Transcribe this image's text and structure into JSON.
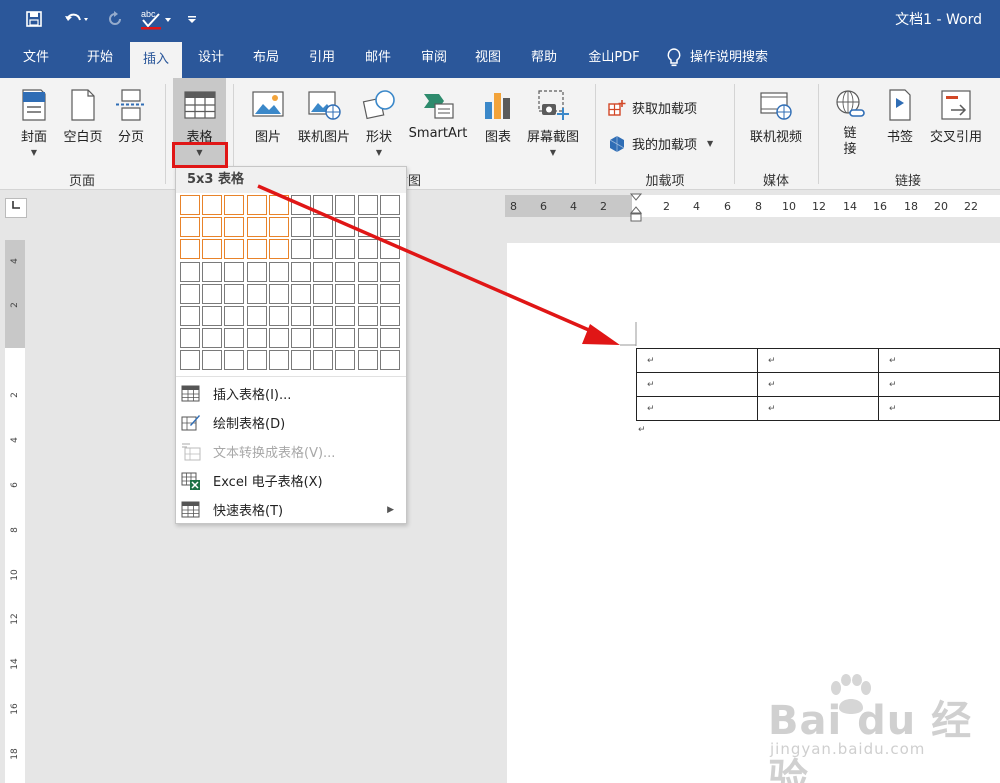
{
  "titlebar": {
    "doc_title": "文档1  -  Word",
    "qat": [
      {
        "name": "save-icon"
      },
      {
        "name": "undo-icon"
      },
      {
        "name": "redo-icon"
      },
      {
        "name": "spelling-icon",
        "text": "abc"
      },
      {
        "name": "customize-qat-icon"
      }
    ]
  },
  "tabs": [
    {
      "label": "文件",
      "active": false
    },
    {
      "label": "开始",
      "active": false
    },
    {
      "label": "插入",
      "active": true
    },
    {
      "label": "设计",
      "active": false
    },
    {
      "label": "布局",
      "active": false
    },
    {
      "label": "引用",
      "active": false
    },
    {
      "label": "邮件",
      "active": false
    },
    {
      "label": "审阅",
      "active": false
    },
    {
      "label": "视图",
      "active": false
    },
    {
      "label": "帮助",
      "active": false
    },
    {
      "label": "金山PDF",
      "active": false
    }
  ],
  "tell_me": "操作说明搜索",
  "ribbon": {
    "buttons": [
      {
        "label": "封面",
        "icon": "cover-page-icon"
      },
      {
        "label": "空白页",
        "icon": "blank-page-icon"
      },
      {
        "label": "分页",
        "icon": "page-break-icon"
      },
      {
        "label": "表格",
        "icon": "table-icon"
      },
      {
        "label": "图片",
        "icon": "picture-icon"
      },
      {
        "label": "联机图片",
        "icon": "online-picture-icon"
      },
      {
        "label": "形状",
        "icon": "shapes-icon"
      },
      {
        "label": "SmartArt",
        "icon": "smartart-icon"
      },
      {
        "label": "图表",
        "icon": "chart-icon"
      },
      {
        "label": "屏幕截图",
        "icon": "screenshot-icon"
      },
      {
        "label": "联机视频",
        "icon": "online-video-icon"
      },
      {
        "label": "链\n接",
        "icon": "link-icon"
      },
      {
        "label": "书签",
        "icon": "bookmark-icon"
      },
      {
        "label": "交叉引用",
        "icon": "cross-reference-icon"
      }
    ],
    "addins": {
      "get": "获取加载项",
      "mine": "我的加载项"
    },
    "groups": {
      "pages": "页面",
      "illustrations_tail": "插图",
      "addins": "加载项",
      "media": "媒体",
      "links": "链接"
    }
  },
  "dropdown": {
    "title": "5x3 表格",
    "grid": {
      "cols": 10,
      "rows": 8,
      "hi_cols": 5,
      "hi_rows": 3
    },
    "items": [
      {
        "label": "插入表格(I)...",
        "icon": "insert-table-icon",
        "disabled": false
      },
      {
        "label": "绘制表格(D)",
        "icon": "draw-table-icon",
        "disabled": false
      },
      {
        "label": "文本转换成表格(V)...",
        "icon": "text-to-table-icon",
        "disabled": true
      },
      {
        "label": "Excel 电子表格(X)",
        "icon": "excel-icon",
        "disabled": false
      },
      {
        "label": "快速表格(T)",
        "icon": "quick-tables-icon",
        "disabled": false,
        "submenu": true
      }
    ]
  },
  "rulers": {
    "horizontal": [
      "8",
      "6",
      "4",
      "2",
      "2",
      "4",
      "6",
      "8",
      "10",
      "12",
      "14",
      "16",
      "18",
      "20",
      "22"
    ],
    "vertical": [
      "4",
      "2",
      "2",
      "4",
      "6",
      "8",
      "10",
      "12",
      "14",
      "16",
      "18"
    ]
  },
  "doc_table": {
    "rows": [
      [
        "↵",
        "↵",
        "↵"
      ],
      [
        "↵",
        "↵",
        "↵"
      ],
      [
        "↵",
        "↵",
        "↵"
      ]
    ],
    "trailing_mark": "↵"
  },
  "watermark": {
    "brand": "Bai du 经验",
    "url": "jingyan.baidu.com"
  },
  "colors": {
    "brand": "#2b579a",
    "highlight": "#e8832a",
    "annotation": "#e01616"
  }
}
